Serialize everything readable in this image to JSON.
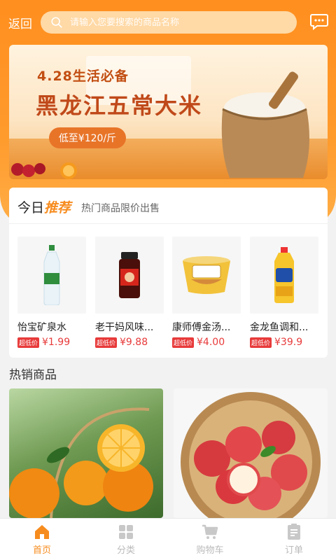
{
  "header": {
    "back_label": "返回",
    "search_placeholder": "请输入您要搜索的商品名称"
  },
  "banner": {
    "subtitle": "4.28生活必备",
    "title": "黑龙江五常大米",
    "price_label": "低至¥120/斤"
  },
  "recommend": {
    "title_plain": "今日",
    "title_em": "推荐",
    "subtitle": "热门商品限价出售",
    "items": [
      {
        "name": "怡宝矿泉水",
        "tag": "超低价",
        "price": "¥1.99"
      },
      {
        "name": "老干妈风味...",
        "tag": "超低价",
        "price": "¥9.88"
      },
      {
        "name": "康师傅金汤...",
        "tag": "超低价",
        "price": "¥4.00"
      },
      {
        "name": "金龙鱼调和...",
        "tag": "超低价",
        "price": "¥39.9"
      }
    ]
  },
  "hot": {
    "title": "热销商品"
  },
  "tabbar": {
    "items": [
      {
        "label": "首页",
        "icon": "home-icon",
        "active": true
      },
      {
        "label": "分类",
        "icon": "grid-icon",
        "active": false
      },
      {
        "label": "购物车",
        "icon": "cart-icon",
        "active": false
      },
      {
        "label": "订单",
        "icon": "order-icon",
        "active": false
      }
    ]
  },
  "colors": {
    "accent": "#f78c1e",
    "price_red": "#e83a3a"
  }
}
